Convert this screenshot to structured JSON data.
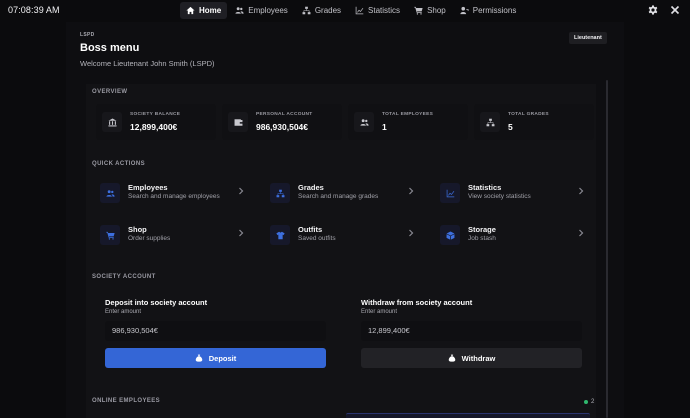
{
  "topbar": {
    "clock": "07:08:39 AM",
    "nav": [
      {
        "label": "Home",
        "icon": "home-icon",
        "active": true
      },
      {
        "label": "Employees",
        "icon": "people-icon",
        "active": false
      },
      {
        "label": "Grades",
        "icon": "hierarchy-icon",
        "active": false
      },
      {
        "label": "Statistics",
        "icon": "chart-icon",
        "active": false
      },
      {
        "label": "Shop",
        "icon": "cart-icon",
        "active": false
      },
      {
        "label": "Permissions",
        "icon": "user-key-icon",
        "active": false
      }
    ]
  },
  "header": {
    "department": "LSPD",
    "title": "Boss menu",
    "welcome": "Welcome Lieutenant John Smith (LSPD)",
    "rank_badge": "Lieutenant"
  },
  "overview": {
    "label": "OVERVIEW",
    "stats": [
      {
        "label": "SOCIETY BALANCE",
        "value": "12,899,400€",
        "icon": "bank-icon"
      },
      {
        "label": "PERSONAL ACCOUNT",
        "value": "986,930,504€",
        "icon": "wallet-icon"
      },
      {
        "label": "TOTAL EMPLOYEES",
        "value": "1",
        "icon": "people-icon"
      },
      {
        "label": "TOTAL GRADES",
        "value": "5",
        "icon": "hierarchy-icon"
      }
    ]
  },
  "quick_actions": {
    "label": "QUICK ACTIONS",
    "items": [
      {
        "title": "Employees",
        "subtitle": "Search and manage employees",
        "icon": "people-icon"
      },
      {
        "title": "Grades",
        "subtitle": "Search and manage grades",
        "icon": "hierarchy-icon"
      },
      {
        "title": "Statistics",
        "subtitle": "View society statistics",
        "icon": "chart-icon"
      },
      {
        "title": "Shop",
        "subtitle": "Order supplies",
        "icon": "cart-icon"
      },
      {
        "title": "Outfits",
        "subtitle": "Saved outfits",
        "icon": "shirt-icon"
      },
      {
        "title": "Storage",
        "subtitle": "Job stash",
        "icon": "box-icon"
      }
    ]
  },
  "society_account": {
    "label": "SOCIETY ACCOUNT",
    "deposit": {
      "title": "Deposit into society account",
      "hint": "Enter amount",
      "placeholder": "986,930,504€",
      "button": "Deposit"
    },
    "withdraw": {
      "title": "Withdraw from society account",
      "hint": "Enter amount",
      "placeholder": "12,899,400€",
      "button": "Withdraw"
    }
  },
  "online_employees": {
    "label": "ONLINE EMPLOYEES",
    "count": "2"
  },
  "colors": {
    "accent": "#3466d6",
    "online": "#2fb86e",
    "background": "#0b0b0d"
  }
}
